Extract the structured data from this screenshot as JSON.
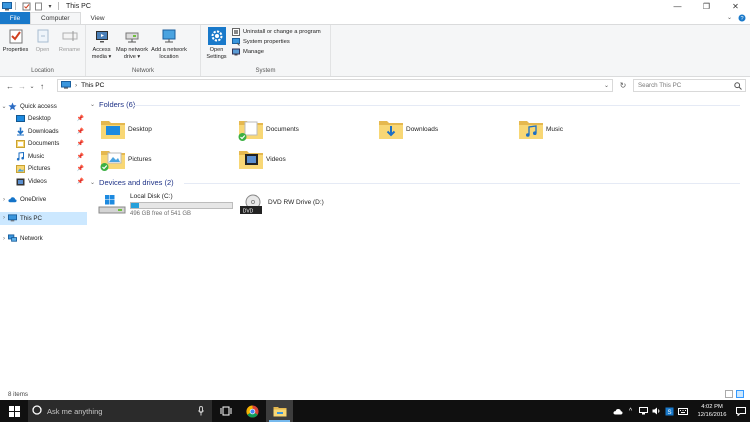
{
  "window": {
    "title": "This PC",
    "controls": {
      "minimize": "—",
      "maximize": "❐",
      "close": "✕"
    }
  },
  "tabs": {
    "file": "File",
    "computer": "Computer",
    "view": "View"
  },
  "ribbon": {
    "location": {
      "label": "Location",
      "properties": "Properties",
      "open": "Open",
      "rename": "Rename"
    },
    "network": {
      "label": "Network",
      "access_media_line1": "Access",
      "access_media_line2": "media ▾",
      "map_drive_line1": "Map network",
      "map_drive_line2": "drive ▾",
      "add_location_line1": "Add a network",
      "add_location_line2": "location"
    },
    "system": {
      "label": "System",
      "open_settings_line1": "Open",
      "open_settings_line2": "Settings",
      "uninstall": "Uninstall or change a program",
      "system_properties": "System properties",
      "manage": "Manage"
    }
  },
  "address": {
    "path": "This PC",
    "search_placeholder": "Search This PC"
  },
  "nav": {
    "quick_access": "Quick access",
    "items": [
      {
        "label": "Desktop",
        "icon": "desktop-icon"
      },
      {
        "label": "Downloads",
        "icon": "downloads-icon"
      },
      {
        "label": "Documents",
        "icon": "documents-icon"
      },
      {
        "label": "Music",
        "icon": "music-icon"
      },
      {
        "label": "Pictures",
        "icon": "pictures-icon"
      },
      {
        "label": "Videos",
        "icon": "videos-icon"
      }
    ],
    "onedrive": "OneDrive",
    "this_pc": "This PC",
    "network": "Network"
  },
  "content": {
    "folders_header": "Folders (6)",
    "folders": [
      "Desktop",
      "Documents",
      "Downloads",
      "Music",
      "Pictures",
      "Videos"
    ],
    "drives_header": "Devices and drives (2)",
    "drives": [
      {
        "name": "Local Disk (C:)",
        "free": "496 GB free of 541 GB",
        "used_fraction": 0.083
      },
      {
        "name": "DVD RW Drive (D:)"
      }
    ]
  },
  "status": {
    "items": "8 items"
  },
  "taskbar": {
    "search_placeholder": "Ask me anything",
    "time": "4:02 PM",
    "date": "12/16/2016"
  },
  "colors": {
    "accent": "#1979ca",
    "folder": "#f8d775",
    "selected": "#cce8ff",
    "section_header": "#1e3287",
    "drive_bar": "#26a0da",
    "taskbar": "#101010"
  }
}
